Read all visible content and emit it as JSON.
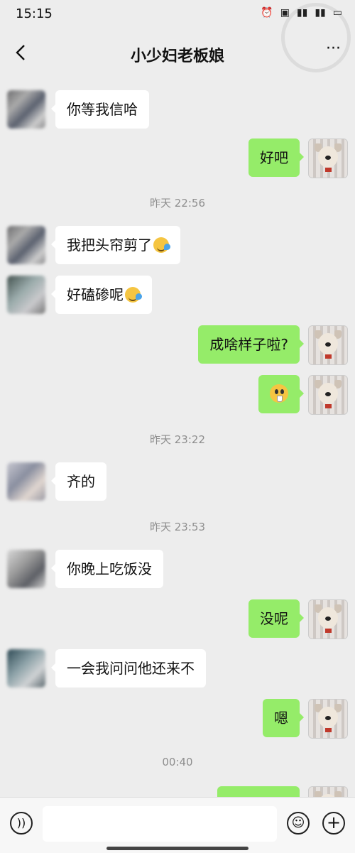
{
  "status_bar": {
    "time": "15:15",
    "icons": [
      "alarm-icon",
      "hd-icon",
      "5g-signal-icon",
      "4g-signal-icon",
      "battery-icon"
    ]
  },
  "header": {
    "title": "小少妇老板娘",
    "back_icon": "chevron-left-icon",
    "more_label": "···"
  },
  "messages": [
    {
      "side": "them",
      "text": "你等我信哈"
    },
    {
      "side": "me",
      "text": "好吧"
    },
    {
      "timestamp": "昨天 22:56"
    },
    {
      "side": "them",
      "text": "我把头帘剪了",
      "emoji": "tears-of-joy-emoji"
    },
    {
      "side": "them",
      "text": "好磕碜呢",
      "emoji": "tears-of-joy-emoji"
    },
    {
      "side": "me",
      "text": "成啥样子啦?"
    },
    {
      "side": "me",
      "emoji": "shocked-fang-emoji"
    },
    {
      "timestamp": "昨天 23:22"
    },
    {
      "side": "them",
      "text": "齐的"
    },
    {
      "timestamp": "昨天 23:53"
    },
    {
      "side": "them",
      "text": "你晚上吃饭没"
    },
    {
      "side": "me",
      "text": "没呢"
    },
    {
      "side": "them",
      "text": "一会我问问他还来不"
    },
    {
      "side": "me",
      "text": "嗯"
    },
    {
      "timestamp": "00:40"
    }
  ],
  "input_bar": {
    "placeholder": "",
    "voice_icon": "voice-icon",
    "emoji_icon": "emoji-icon",
    "plus_icon": "plus-icon"
  },
  "colors": {
    "background": "#ededed",
    "my_bubble": "#95ec69",
    "their_bubble": "#ffffff",
    "timestamp": "#8e8e8e"
  }
}
